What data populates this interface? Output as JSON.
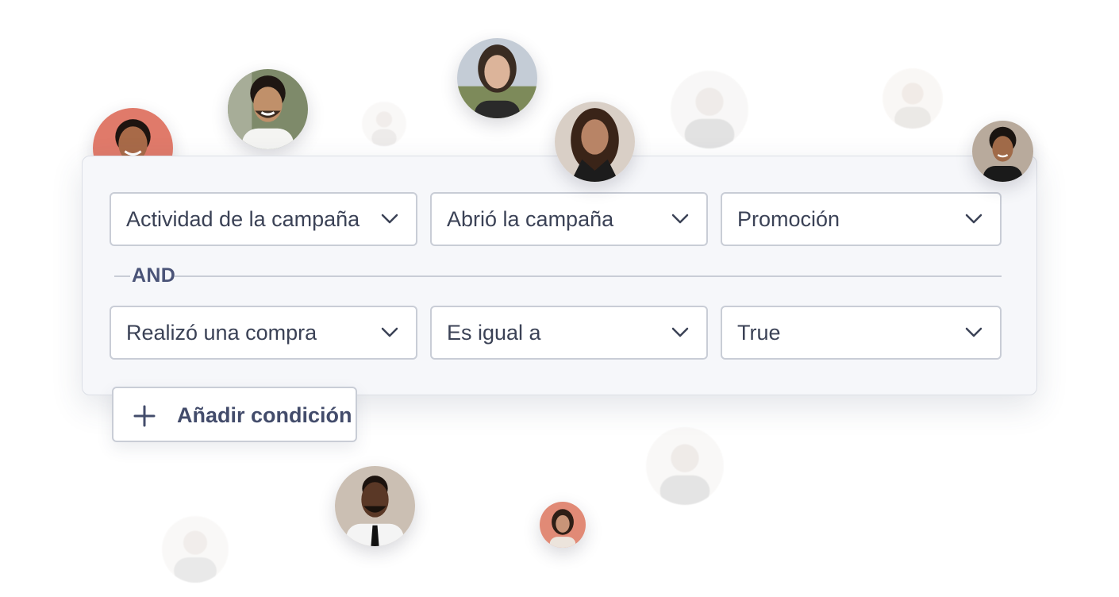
{
  "filter_panel": {
    "rows": [
      {
        "field": "Actividad de la campaña",
        "operator": "Abrió la campaña",
        "value": "Promoción"
      },
      {
        "field": "Realizó una compra",
        "operator": "Es igual a",
        "value": "True"
      }
    ],
    "connector": "AND"
  },
  "add_condition": {
    "label": "Añadir condición",
    "icon": "plus-icon"
  },
  "colors": {
    "panel_bg": "#f6f7fa",
    "border": "#c9cdd6",
    "text": "#3b4256",
    "accent_text": "#4b5478"
  }
}
